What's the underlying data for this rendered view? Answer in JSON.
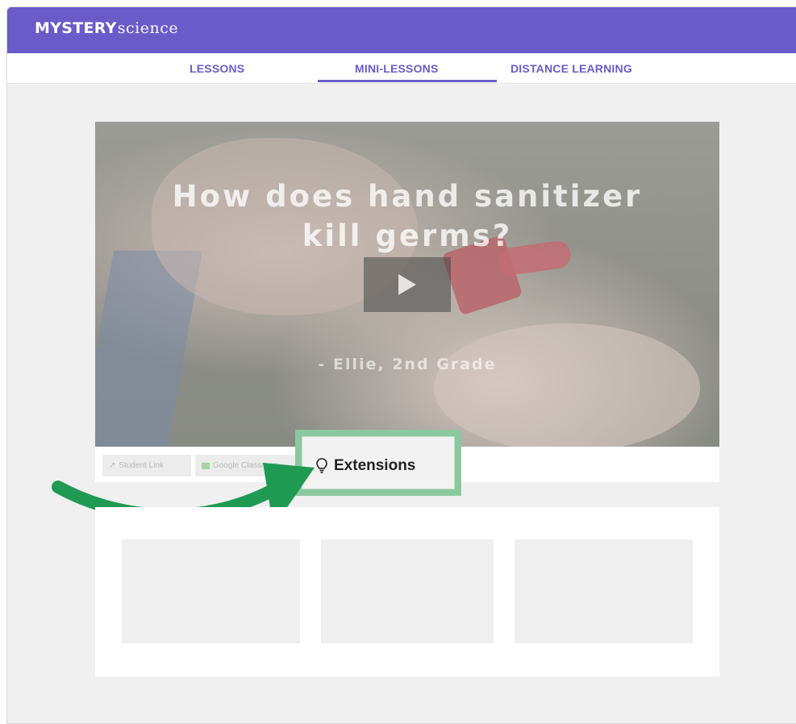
{
  "brand": {
    "bold": "MYSTERY",
    "light": "science"
  },
  "nav": {
    "items": [
      "LESSONS",
      "MINI-LESSONS",
      "DISTANCE LEARNING"
    ],
    "active": "MINI-LESSONS"
  },
  "video": {
    "title_line1": "How does hand sanitizer",
    "title_line2": "kill germs?",
    "attribution": "- Ellie, 2nd Grade"
  },
  "actions": {
    "student_link": "Student Link",
    "google_classroom": "Google Classroom",
    "extensions": "Extensions"
  },
  "colors": {
    "brand": "#6a5bc8",
    "highlight": "#8cc89f",
    "arrow": "#1f9a53"
  },
  "icons": [
    "play-icon",
    "share-arrow-icon",
    "google-classroom-icon",
    "lightbulb-icon",
    "curved-arrow-icon"
  ]
}
